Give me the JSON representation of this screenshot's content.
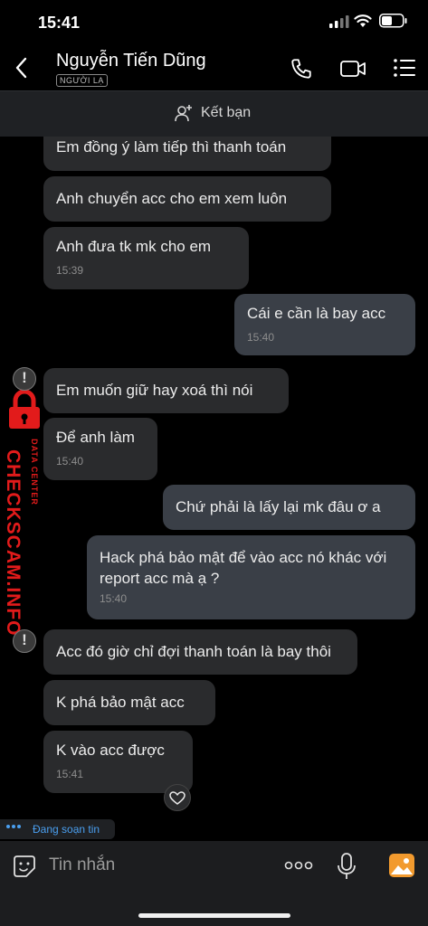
{
  "status_bar": {
    "time": "15:41"
  },
  "header": {
    "contact_name": "Nguyễn Tiến Dũng",
    "tag": "NGƯỜI LẠ"
  },
  "add_friend": {
    "label": "Kết bạn"
  },
  "messages": [
    {
      "text": "Em đồng ý làm tiếp thì thanh toán",
      "sender": "other"
    },
    {
      "text": "Anh chuyển acc cho em xem luôn",
      "sender": "other"
    },
    {
      "text": "Anh đưa tk mk cho em",
      "sender": "other",
      "time": "15:39"
    },
    {
      "text": "Cái e cần là bay acc",
      "sender": "me",
      "time": "15:40"
    },
    {
      "text": "Em muốn giữ hay xoá thì nói",
      "sender": "other"
    },
    {
      "text": "Để anh làm",
      "sender": "other",
      "time": "15:40"
    },
    {
      "text": "Chứ phải là lấy lại mk đâu ơ a",
      "sender": "me"
    },
    {
      "text": "Hack phá bảo mật để vào acc nó khác với report acc mà ạ ?",
      "sender": "me",
      "time": "15:40"
    },
    {
      "text": "Acc đó giờ chỉ đợi thanh toán là bay thôi",
      "sender": "other"
    },
    {
      "text": "K phá bảo mật acc",
      "sender": "other"
    },
    {
      "text": "K vào acc được",
      "sender": "other",
      "time": "15:41"
    }
  ],
  "watermark": {
    "brand": "CHECKSCAM.INFO",
    "subtitle": "DATA CENTER",
    "color": "#e21b1b"
  },
  "typing_indicator": "Đang soạn tin",
  "composer": {
    "placeholder": "Tin nhắn"
  },
  "icons": [
    "back-arrow-icon",
    "phone-icon",
    "video-camera-icon",
    "menu-list-icon",
    "add-user-icon",
    "heart-icon",
    "sticker-icon",
    "more-icon",
    "microphone-icon",
    "image-gallery-icon",
    "lock-icon"
  ],
  "colors": {
    "background": "#000000",
    "incoming_bubble": "#2a2b2d",
    "outgoing_bubble": "#3a3f47",
    "accent": "#4a9ff0"
  }
}
